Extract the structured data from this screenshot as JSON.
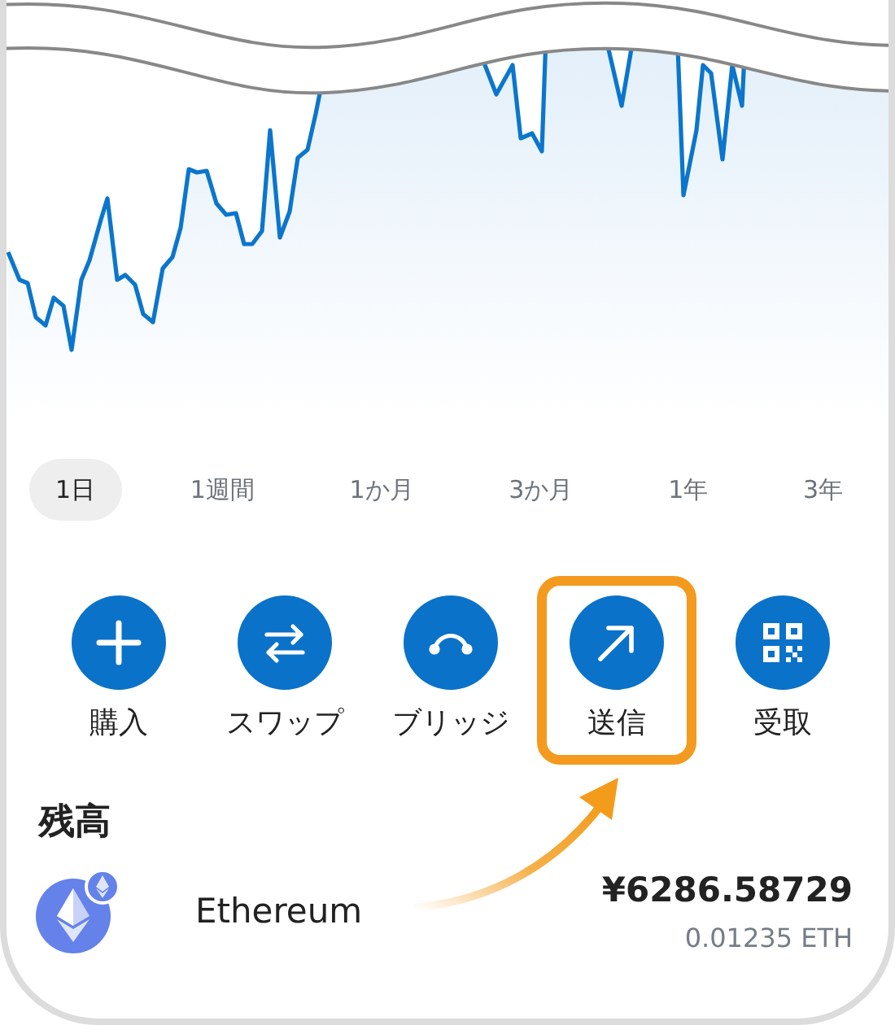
{
  "time_ranges": [
    {
      "label": "1日",
      "selected": true
    },
    {
      "label": "1週間",
      "selected": false
    },
    {
      "label": "1か月",
      "selected": false
    },
    {
      "label": "3か月",
      "selected": false
    },
    {
      "label": "1年",
      "selected": false
    },
    {
      "label": "3年",
      "selected": false
    }
  ],
  "actions": [
    {
      "kind": "plus",
      "label": "購入",
      "highlighted": false
    },
    {
      "kind": "swap",
      "label": "スワップ",
      "highlighted": false
    },
    {
      "kind": "bridge",
      "label": "ブリッジ",
      "highlighted": false
    },
    {
      "kind": "send",
      "label": "送信",
      "highlighted": true
    },
    {
      "kind": "receive",
      "label": "受取",
      "highlighted": false
    }
  ],
  "balance": {
    "title": "残高",
    "tokens": [
      {
        "name": "Ethereum",
        "fiat_value": "¥6286.58729",
        "amount": "0.01235 ETH"
      }
    ]
  }
}
